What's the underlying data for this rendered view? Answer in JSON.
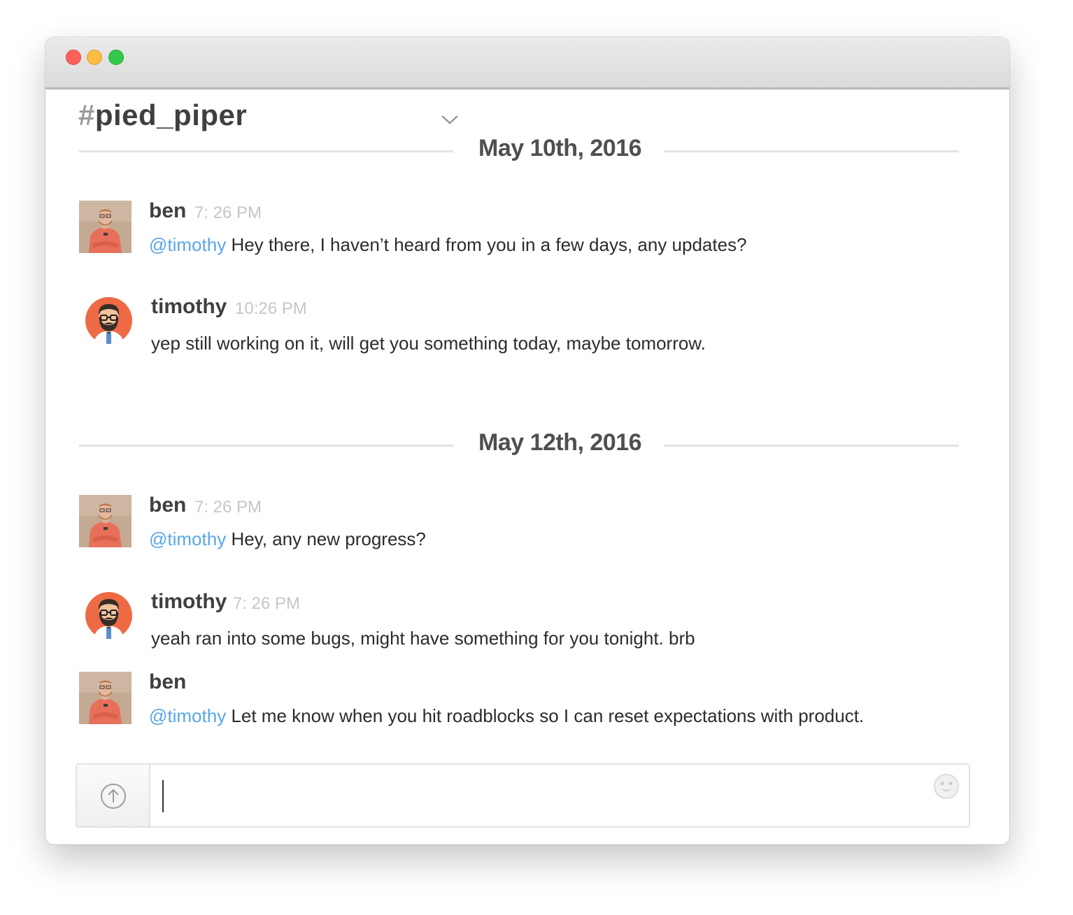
{
  "window": {
    "controls": [
      "close-button",
      "minimize-button",
      "zoom-button"
    ]
  },
  "channel": {
    "hash": "#",
    "name": "pied_piper"
  },
  "days": [
    {
      "date": "May 10th, 2016",
      "messages": [
        {
          "author": "ben",
          "time": "7: 26 PM",
          "mention": "@timothy",
          "text": "Hey there, I haven’t heard from you in a few days, any updates?"
        },
        {
          "author": "timothy",
          "time": "10:26 PM",
          "mention": "",
          "text": "yep still working on it, will get you something today, maybe tomorrow."
        }
      ]
    },
    {
      "date": "May 12th, 2016",
      "messages": [
        {
          "author": "ben",
          "time": "7: 26 PM",
          "mention": "@timothy",
          "text": "Hey, any new progress?"
        },
        {
          "author": "timothy",
          "time": "7: 26 PM",
          "mention": "",
          "text": "yeah ran into some bugs, might have something for you tonight. brb"
        },
        {
          "author": "ben",
          "time": "",
          "mention": "@timothy",
          "text": "Let me know when you hit roadblocks so I can reset expectations with product."
        }
      ]
    }
  ],
  "composer": {
    "value": "",
    "upload_icon": "arrow-up-circle-icon",
    "emoji_icon": "smiley-face-icon"
  },
  "colors": {
    "mention": "#5aa6e9",
    "timothy_avatar_bg": "#ee6a45",
    "close": "#fc605c",
    "minimize": "#fdbc40",
    "zoom": "#34c84a"
  }
}
